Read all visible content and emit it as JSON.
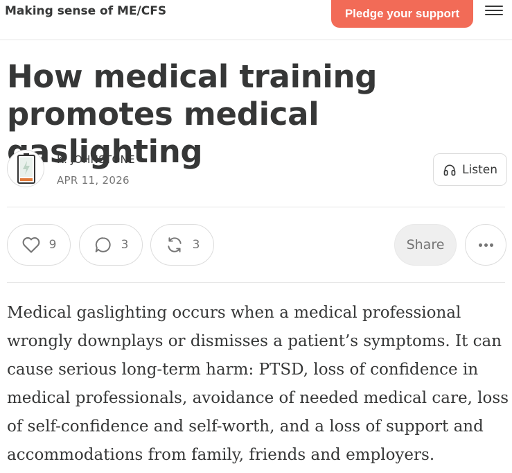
{
  "header": {
    "site_name": "Making sense of ME/CFS",
    "pledge_label": "Pledge your support"
  },
  "post": {
    "title": "How medical training promotes medical gaslighting",
    "author": "K. JOHNSTONE",
    "date": "APR 11, 2026",
    "listen_label": "Listen",
    "likes": "9",
    "comments": "3",
    "restacks": "3",
    "share_label": "Share",
    "body": "Medical gaslighting occurs when a medical professional wrongly downplays or dismisses a patient’s symptoms. It can cause serious long-term harm: PTSD, loss of confidence in medical professionals, avoidance of needed medical care, loss of self-confidence and self-worth, and a loss of support and accommodations from family, friends and employers."
  },
  "icons": {
    "menu": "hamburger-menu-icon",
    "headphones": "headphones-icon",
    "like": "heart-icon",
    "comment": "comment-bubble-icon",
    "restack": "restack-arrows-icon",
    "more": "ellipsis-icon",
    "avatar": "battery-icon"
  },
  "colors": {
    "accent": "#f26b57",
    "text": "#363737",
    "muted": "#757575"
  }
}
